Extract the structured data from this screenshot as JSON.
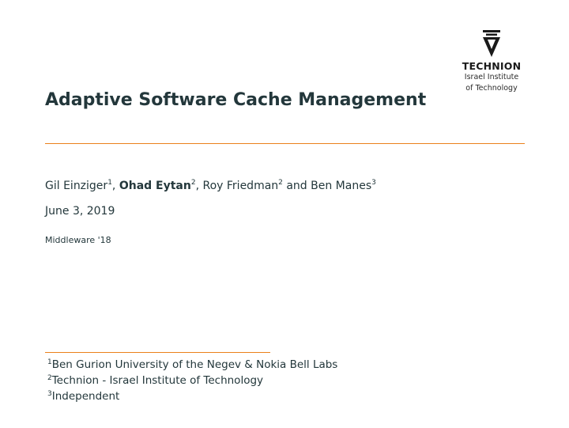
{
  "logo": {
    "name": "TECHNION",
    "line1": "Israel Institute",
    "line2": "of Technology"
  },
  "title": "Adaptive Software Cache Management",
  "authors": [
    {
      "name": "Gil Einziger",
      "mark": "1",
      "sep": ", "
    },
    {
      "name": "Ohad Eytan",
      "mark": "2",
      "sep": ", "
    },
    {
      "name": "Roy Friedman",
      "mark": "2",
      "sep": " and "
    },
    {
      "name": "Ben Manes",
      "mark": "3",
      "sep": ""
    }
  ],
  "date": "June 3, 2019",
  "institute": "Middleware '18",
  "footnotes": [
    {
      "mark": "1",
      "text": "Ben Gurion University of the Negev & Nokia Bell Labs"
    },
    {
      "mark": "2",
      "text": "Technion - Israel Institute of Technology"
    },
    {
      "mark": "3",
      "text": "Independent"
    }
  ],
  "colors": {
    "accent": "#eb811b",
    "text": "#23373b"
  }
}
